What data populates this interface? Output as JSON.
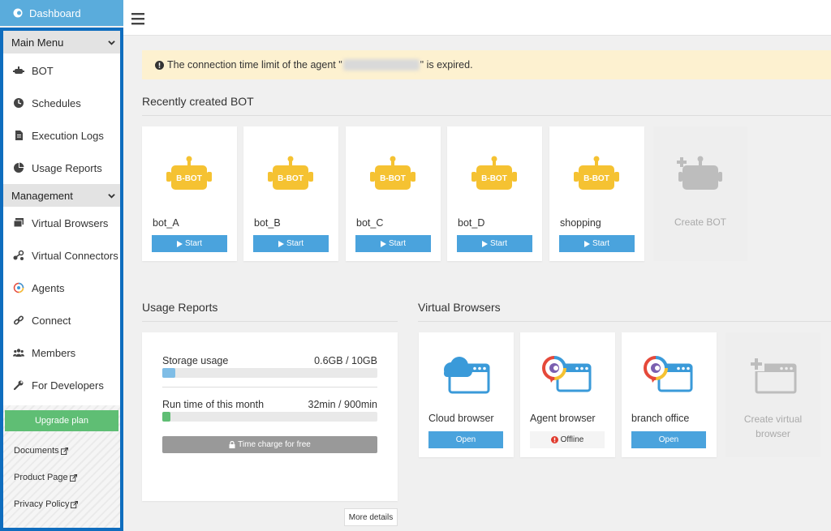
{
  "brand": {
    "title": "Dashboard"
  },
  "sidebar": {
    "main_menu": {
      "label": "Main Menu",
      "items": [
        {
          "label": "BOT",
          "icon": "robot-icon"
        },
        {
          "label": "Schedules",
          "icon": "clock-icon"
        },
        {
          "label": "Execution Logs",
          "icon": "document-icon"
        },
        {
          "label": "Usage Reports",
          "icon": "pie-chart-icon"
        }
      ]
    },
    "management": {
      "label": "Management",
      "items": [
        {
          "label": "Virtual Browsers",
          "icon": "windows-icon"
        },
        {
          "label": "Virtual Connectors",
          "icon": "connector-icon"
        },
        {
          "label": "Agents",
          "icon": "agent-icon"
        },
        {
          "label": "Connect",
          "icon": "link-icon"
        },
        {
          "label": "Members",
          "icon": "users-icon"
        },
        {
          "label": "For Developers",
          "icon": "wrench-icon"
        }
      ]
    },
    "upgrade_label": "Upgrade plan",
    "footer_links": [
      "Documents",
      "Product Page",
      "Privacy Policy"
    ]
  },
  "alert": {
    "prefix": "The connection time limit of the agent \"",
    "suffix": "\" is expired."
  },
  "recent_bots": {
    "title": "Recently created BOT",
    "badge_text": "B-BOT",
    "start_label": "Start",
    "bots": [
      "bot_A",
      "bot_B",
      "bot_C",
      "bot_D",
      "shopping"
    ],
    "create_label": "Create BOT"
  },
  "usage": {
    "title": "Usage Reports",
    "storage_label": "Storage usage",
    "storage_value": "0.6GB / 10GB",
    "storage_fraction": 0.06,
    "runtime_label": "Run time of this month",
    "runtime_value": "32min / 900min",
    "runtime_fraction": 0.036,
    "time_charge_label": "Time charge for free",
    "more_label": "More details"
  },
  "virtual_browsers": {
    "title": "Virtual Browsers",
    "browsers": [
      {
        "name": "Cloud browser",
        "action": "Open"
      },
      {
        "name": "Agent browser",
        "status": "Offline"
      },
      {
        "name": "branch office",
        "action": "Open"
      }
    ],
    "create_line1": "Create virtual",
    "create_line2": "browser"
  },
  "colors": {
    "brand_blue": "#5aacdc",
    "sidebar_border": "#0f6dbe",
    "button_blue": "#4aa3dd",
    "bot_yellow": "#f5c232",
    "upgrade_green": "#5fbe74",
    "alert_bg": "#fdf1d0"
  }
}
